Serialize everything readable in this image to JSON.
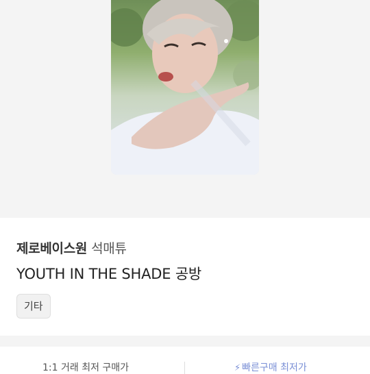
{
  "product": {
    "group": "제로베이스원",
    "member": "석매튜",
    "album": "YOUTH IN THE SHADE 공방",
    "category": "기타"
  },
  "price_tabs": {
    "left_label": "1:1 거래 최저 구매가",
    "right_label": "빠른구매 최저가",
    "right_icon": "lightning-bolt-icon"
  },
  "colors": {
    "background": "#f4f4f4",
    "chip_bg": "#f1f1f1",
    "accent": "#7a8fd6"
  }
}
